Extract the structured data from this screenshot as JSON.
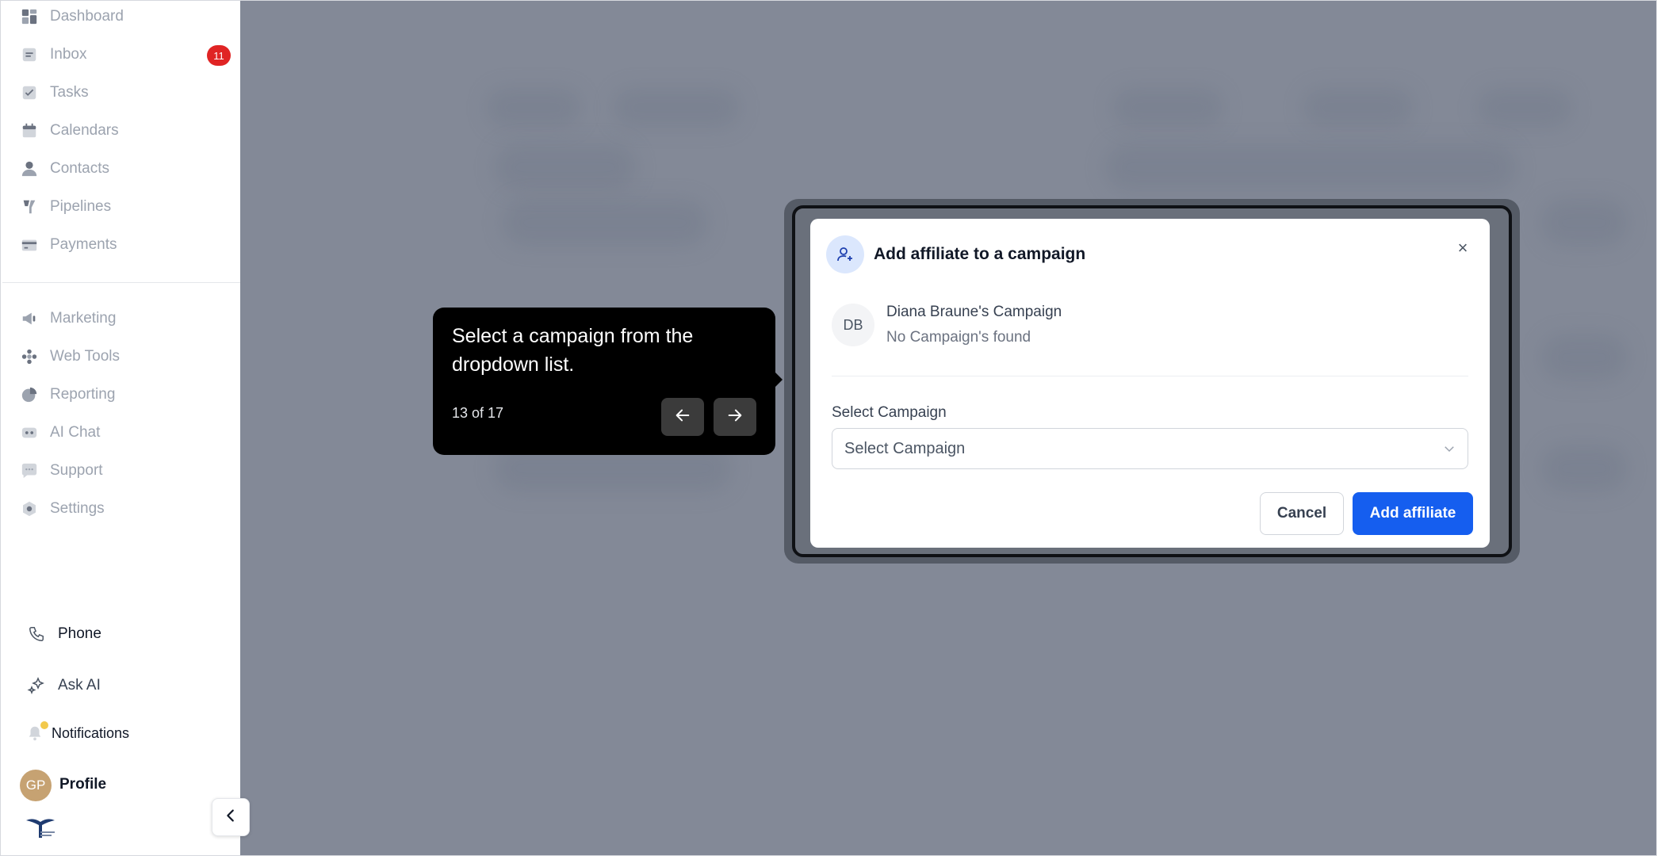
{
  "sidebar": {
    "items": [
      {
        "label": "Dashboard",
        "icon": "dashboard-icon"
      },
      {
        "label": "Inbox",
        "icon": "inbox-icon"
      },
      {
        "label": "Tasks",
        "icon": "tasks-icon"
      },
      {
        "label": "Calendars",
        "icon": "calendar-icon"
      },
      {
        "label": "Contacts",
        "icon": "contacts-icon"
      },
      {
        "label": "Pipelines",
        "icon": "pipelines-icon"
      },
      {
        "label": "Payments",
        "icon": "payments-icon"
      },
      {
        "label": "Marketing",
        "icon": "marketing-icon"
      },
      {
        "label": "Web Tools",
        "icon": "web-tools-icon"
      },
      {
        "label": "Reporting",
        "icon": "reporting-icon"
      },
      {
        "label": "AI Chat",
        "icon": "ai-chat-icon"
      },
      {
        "label": "Support",
        "icon": "support-icon"
      },
      {
        "label": "Settings",
        "icon": "settings-icon"
      }
    ],
    "inbox_badge": "11",
    "phone_label": "Phone",
    "ask_ai_label": "Ask AI",
    "notifications_label": "Notifications",
    "avatar_initials": "GP",
    "profile_label": "Profile"
  },
  "modal": {
    "title": "Add affiliate to a campaign",
    "close_symbol": "×",
    "avatar_initials": "DB",
    "campaign_owner": "Diana Braune's Campaign",
    "campaign_status": "No Campaign's found",
    "select_label": "Select Campaign",
    "select_value": "Select Campaign",
    "cancel_label": "Cancel",
    "add_label": "Add affiliate"
  },
  "tour": {
    "text": "Select a campaign from the dropdown list.",
    "step": "13 of 17"
  },
  "colors": {
    "primary": "#155eef",
    "badge": "#e02424",
    "overlay": "#838997",
    "notification_dot": "#f2c94c"
  }
}
